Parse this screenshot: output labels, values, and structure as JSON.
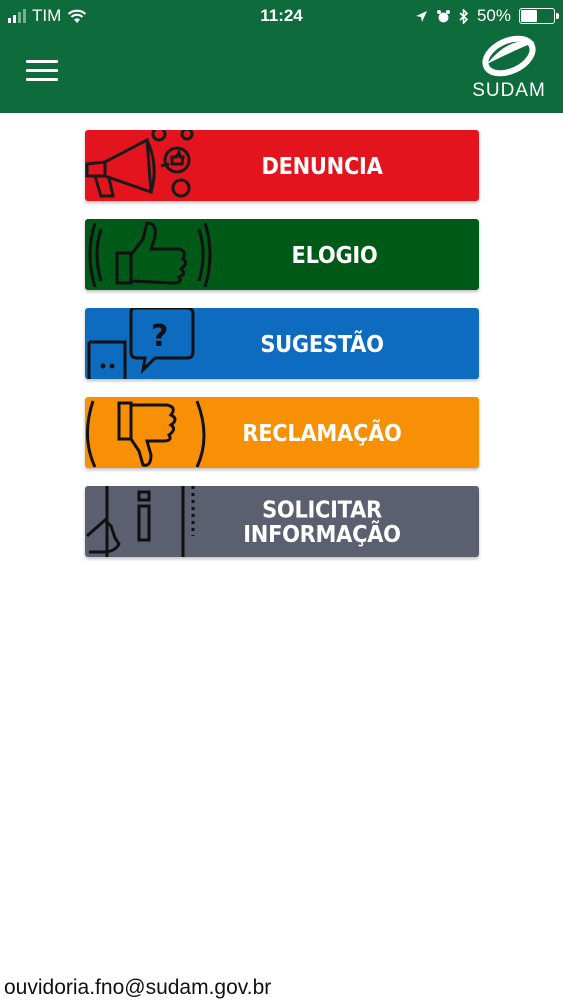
{
  "status_bar": {
    "carrier": "TIM",
    "time": "11:24",
    "battery": "50%"
  },
  "header": {
    "logo_text": "SUDAM",
    "logo_icon": "sudam-logo-icon",
    "menu_icon": "hamburger-icon"
  },
  "menu": {
    "items": [
      {
        "label": "DENUNCIA",
        "color": "#e3141e",
        "icon": "megaphone-icon"
      },
      {
        "label": "ELOGIO",
        "color": "#005a17",
        "icon": "thumbs-up-icon"
      },
      {
        "label": "SUGESTÃO",
        "color": "#0e6cc0",
        "icon": "speech-bubbles-icon"
      },
      {
        "label": "RECLAMAÇÃO",
        "color": "#f79004",
        "icon": "thumbs-down-icon"
      },
      {
        "label_line1": "SOLICITAR",
        "label_line2": "INFORMAÇÃO",
        "color": "#5c5f6f",
        "icon": "info-icon"
      }
    ]
  },
  "footer": {
    "email": "ouvidoria.fno@sudam.gov.br"
  }
}
